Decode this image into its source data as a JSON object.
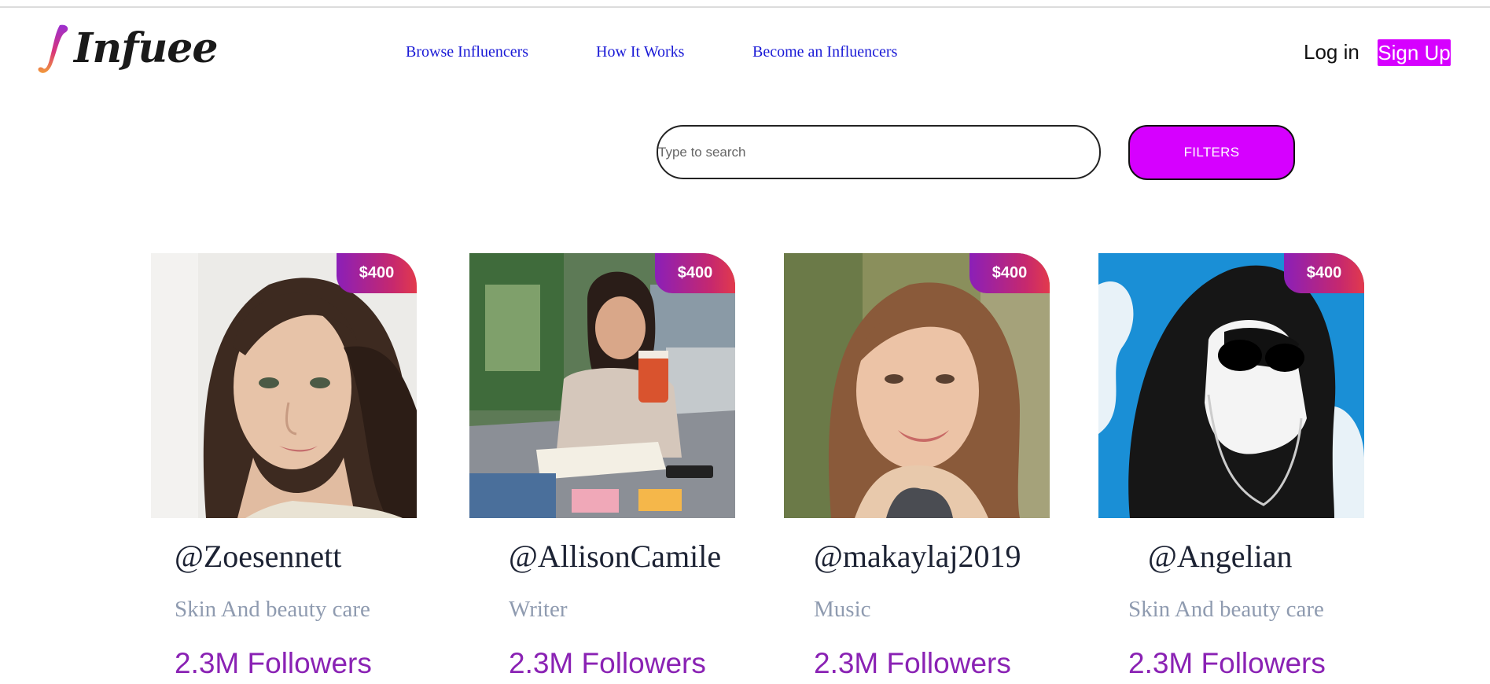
{
  "brand": {
    "name": "Infuee",
    "logo_icon": "gradient-i-logo-icon"
  },
  "nav": {
    "items": [
      {
        "label": "Browse Influencers"
      },
      {
        "label": "How It Works"
      },
      {
        "label": "Become an Influencers"
      }
    ],
    "login_label": "Log in",
    "signup_label": "Sign Up"
  },
  "search": {
    "placeholder": "Type to search",
    "value": "",
    "filters_label": "FILTERS"
  },
  "colors": {
    "accent": "#d600ff",
    "link": "#1a1ad6",
    "followers": "#8a22b4",
    "category": "#8f9bb0",
    "price_gradient": [
      "#8b1fb8",
      "#e23a4c"
    ]
  },
  "cards": [
    {
      "price": "$400",
      "handle": "@Zoesennett",
      "category": "Skin And beauty care",
      "followers": "2.3M Followers",
      "photo": "portrait-woman-dark-hair"
    },
    {
      "price": "$400",
      "handle": "@AllisonCamile",
      "category": "Writer",
      "followers": "2.3M Followers",
      "photo": "woman-writing-with-coffee"
    },
    {
      "price": "$400",
      "handle": "@makaylaj2019",
      "category": "Music",
      "followers": "2.3M Followers",
      "photo": "portrait-woman-smiling"
    },
    {
      "price": "$400",
      "handle": "@Angelian",
      "category": "Skin And beauty care",
      "followers": "2.3M Followers",
      "photo": "hooded-figure-sunglasses-illustration"
    }
  ]
}
